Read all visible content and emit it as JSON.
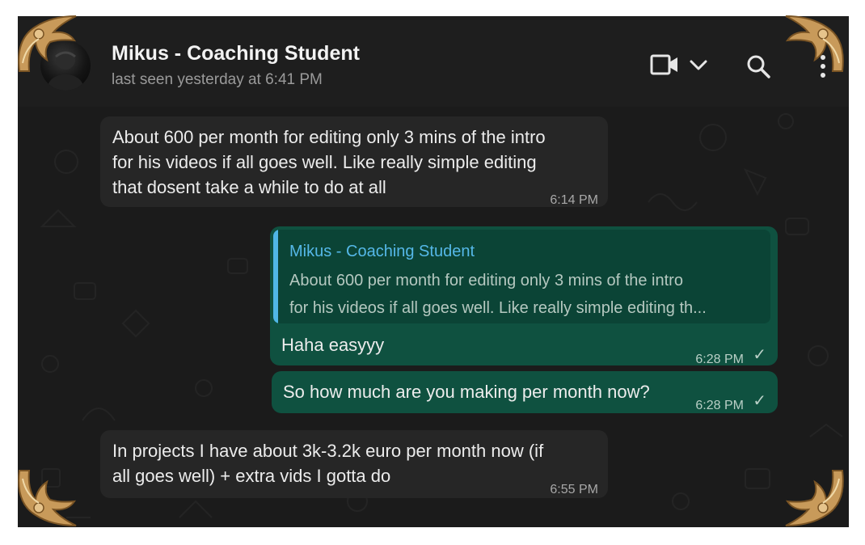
{
  "chat": {
    "contact_name": "Mikus - Coaching Student",
    "last_seen": "last seen yesterday at 6:41 PM"
  },
  "header_icons": [
    "video-call-icon",
    "chevron-down-icon",
    "search-icon",
    "more-options-icon"
  ],
  "messages": [
    {
      "direction": "incoming",
      "lines": [
        "About 600 per month for editing only 3 mins of the intro",
        "for his videos if all goes well. Like really simple editing",
        "that dosent take a while to do at all"
      ],
      "time": "6:14 PM"
    },
    {
      "direction": "outgoing",
      "reply_to": {
        "author": "Mikus - Coaching Student",
        "lines": [
          "About 600 per month for editing only 3 mins of the intro",
          "for his videos if all goes well. Like really simple editing th..."
        ]
      },
      "text": "Haha easyyy",
      "time": "6:28 PM",
      "status": "sent"
    },
    {
      "direction": "outgoing",
      "text": "So how much are you making per month now?",
      "time": "6:28 PM",
      "status": "sent"
    },
    {
      "direction": "incoming",
      "lines": [
        "In projects I have about 3k-3.2k euro per month now (if",
        "all goes well) + extra vids I gotta do"
      ],
      "time": "6:55 PM"
    }
  ],
  "colors": {
    "background": "#1b1b1b",
    "incoming_bubble": "#262626",
    "outgoing_bubble": "#0f5140",
    "quote_accent": "#4fb7e6",
    "ornament_gold": "#c89a5a"
  }
}
